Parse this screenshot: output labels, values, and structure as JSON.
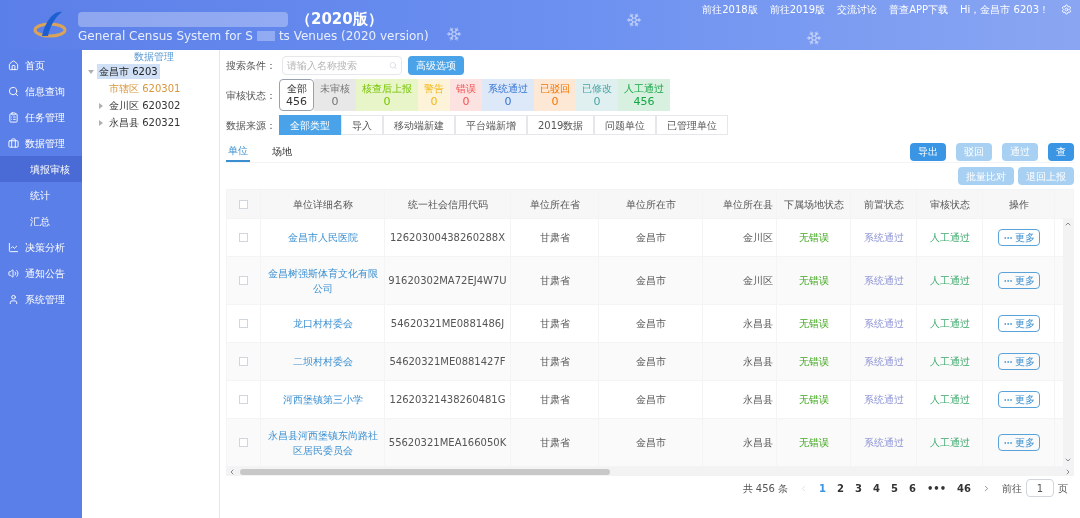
{
  "header": {
    "title": "（2020版）",
    "subtitle_start": "General Census System for S",
    "subtitle_end": "ts Venues (2020 version)",
    "links": [
      "前往2018版",
      "前往2019版",
      "交流讨论",
      "普查APP下载"
    ],
    "greeting": "Hi，金昌市 6203！"
  },
  "sidebar": {
    "items": [
      {
        "label": "首页",
        "selected": false
      },
      {
        "label": "信息查询",
        "selected": false
      },
      {
        "label": "任务管理",
        "selected": false
      },
      {
        "label": "数据管理",
        "selected": false,
        "expanded": true,
        "children": [
          {
            "label": "填报审核",
            "selected": true
          },
          {
            "label": "统计",
            "selected": false
          },
          {
            "label": "汇总",
            "selected": false
          }
        ]
      },
      {
        "label": "决策分析",
        "selected": false
      },
      {
        "label": "通知公告",
        "selected": false
      },
      {
        "label": "系统管理",
        "selected": false
      }
    ]
  },
  "tree": {
    "title": "数据管理",
    "nodes": [
      {
        "label": "金昌市 6203",
        "selected": true,
        "expanded": true,
        "children": [
          {
            "label": "市辖区 620301",
            "selected": false
          },
          {
            "label": "金川区 620302",
            "selected": false,
            "expanded": false
          },
          {
            "label": "永昌县 620321",
            "selected": false,
            "expanded": false
          }
        ]
      }
    ]
  },
  "filters": {
    "search_label": "搜索条件：",
    "search_placeholder": "请输入名称搜索",
    "advanced_button": "高级选项",
    "status_label": "审核状态：",
    "statuses": [
      {
        "label": "全部",
        "count": "456",
        "selected": true,
        "color": "#ffffff"
      },
      {
        "label": "未审核",
        "count": "0",
        "selected": false,
        "color": "#e8e8e8"
      },
      {
        "label": "核查后上报",
        "count": "0",
        "selected": false,
        "color": "#e8f5c8"
      },
      {
        "label": "警告",
        "count": "0",
        "selected": false,
        "color": "#fdf3d8"
      },
      {
        "label": "错误",
        "count": "0",
        "selected": false,
        "color": "#fde2e2"
      },
      {
        "label": "系统通过",
        "count": "0",
        "selected": false,
        "color": "#dde8f8"
      },
      {
        "label": "已驳回",
        "count": "0",
        "selected": false,
        "color": "#fde8d5"
      },
      {
        "label": "已修改",
        "count": "0",
        "selected": false,
        "color": "#e0f0f0"
      },
      {
        "label": "人工通过",
        "count": "456",
        "selected": false,
        "color": "#d8f0e0"
      }
    ],
    "source_label": "数据来源：",
    "sources": [
      {
        "label": "全部类型",
        "selected": true
      },
      {
        "label": "导入",
        "selected": false
      },
      {
        "label": "移动端新建",
        "selected": false
      },
      {
        "label": "平台端新增",
        "selected": false
      },
      {
        "label": "2019数据",
        "selected": false
      },
      {
        "label": "问题单位",
        "selected": false
      },
      {
        "label": "已管理单位",
        "selected": false
      }
    ]
  },
  "tabs": [
    {
      "label": "单位",
      "selected": true
    },
    {
      "label": "场地",
      "selected": false
    }
  ],
  "actions": [
    {
      "label": "导出",
      "disabled": false
    },
    {
      "label": "驳回",
      "disabled": true
    },
    {
      "label": "通过",
      "disabled": true
    },
    {
      "label": "查",
      "disabled": false
    }
  ],
  "sub_actions": [
    {
      "label": "批量比对",
      "disabled": true
    },
    {
      "label": "退回上报",
      "disabled": true
    }
  ],
  "table": {
    "select_all": {
      "checked": false
    },
    "columns": [
      "单位详细名称",
      "统一社会信用代码",
      "单位所在省",
      "单位所在市",
      "单位所在县",
      "下属场地状态",
      "前置状态",
      "审核状态",
      "操作"
    ],
    "rows": [
      {
        "checked": false,
        "name": "金昌市人民医院",
        "code": "12620300438260288X",
        "province": "甘肃省",
        "city": "金昌市",
        "county": "金川区",
        "sub_status": "无错误",
        "pre_status": "系统通过",
        "audit_status": "人工通过",
        "action": "更多"
      },
      {
        "checked": false,
        "name": "金昌树强斯体育文化有限公司",
        "code": "91620302MA72EJ4W7U",
        "province": "甘肃省",
        "city": "金昌市",
        "county": "金川区",
        "sub_status": "无错误",
        "pre_status": "系统通过",
        "audit_status": "人工通过",
        "action": "更多"
      },
      {
        "checked": false,
        "name": "龙口村村委会",
        "code": "54620321ME0881486J",
        "province": "甘肃省",
        "city": "金昌市",
        "county": "永昌县",
        "sub_status": "无错误",
        "pre_status": "系统通过",
        "audit_status": "人工通过",
        "action": "更多"
      },
      {
        "checked": false,
        "name": "二坝村村委会",
        "code": "54620321ME0881427F",
        "province": "甘肃省",
        "city": "金昌市",
        "county": "永昌县",
        "sub_status": "无错误",
        "pre_status": "系统通过",
        "audit_status": "人工通过",
        "action": "更多"
      },
      {
        "checked": false,
        "name": "河西堡镇第三小学",
        "code": "12620321438260481G",
        "province": "甘肃省",
        "city": "金昌市",
        "county": "永昌县",
        "sub_status": "无错误",
        "pre_status": "系统通过",
        "audit_status": "人工通过",
        "action": "更多"
      },
      {
        "checked": false,
        "name": "永昌县河西堡镇东尚路社区居民委员会",
        "code": "55620321MEA166050K",
        "province": "甘肃省",
        "city": "金昌市",
        "county": "永昌县",
        "sub_status": "无错误",
        "pre_status": "系统通过",
        "audit_status": "人工通过",
        "action": "更多"
      }
    ]
  },
  "pagination": {
    "total": "共 456 条",
    "pages": [
      {
        "label": "1",
        "selected": true
      },
      {
        "label": "2",
        "selected": false
      },
      {
        "label": "3",
        "selected": false
      },
      {
        "label": "4",
        "selected": false
      },
      {
        "label": "5",
        "selected": false
      },
      {
        "label": "6",
        "selected": false
      },
      {
        "label": "•••",
        "selected": false
      },
      {
        "label": "46",
        "selected": false
      }
    ],
    "goto_label": "前往",
    "goto_value": "1",
    "page_unit": "页"
  }
}
